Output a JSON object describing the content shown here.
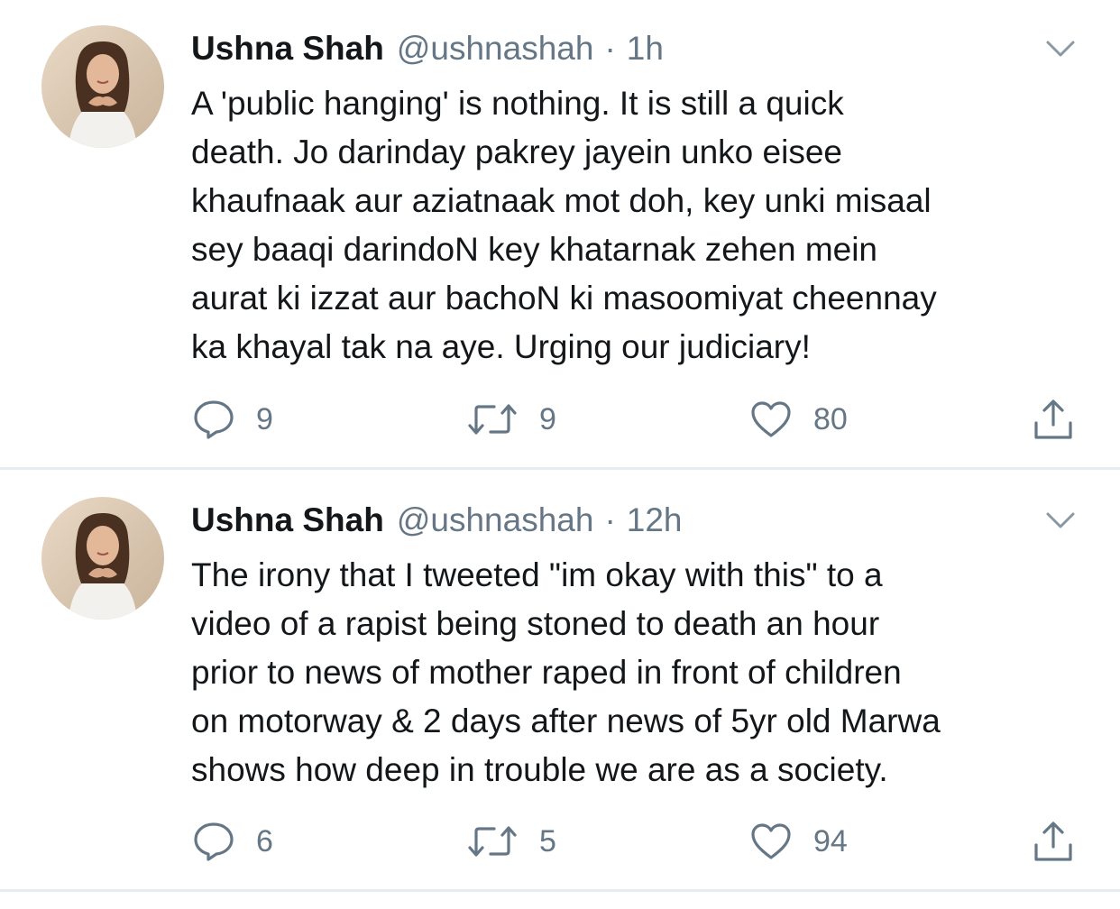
{
  "tweets": [
    {
      "display_name": "Ushna Shah",
      "handle": "@ushnashah",
      "separator": "·",
      "time": "1h",
      "text": "A 'public hanging' is nothing. It is still a quick\ndeath. Jo darinday pakrey jayein unko eisee\nkhaufnaak aur aziatnaak mot doh, key unki misaal\nsey baaqi darindoN key khatarnak zehen mein\naurat ki izzat aur bachoN ki masoomiyat cheennay\nka khayal tak na aye. Urging our judiciary!",
      "replies": "9",
      "retweets": "9",
      "likes": "80",
      "icons": {
        "reply": "reply-icon",
        "retweet": "retweet-icon",
        "like": "heart-icon",
        "share": "share-icon",
        "menu": "chevron-down-icon"
      }
    },
    {
      "display_name": "Ushna Shah",
      "handle": "@ushnashah",
      "separator": "·",
      "time": "12h",
      "text": "The irony that I tweeted \"im okay with this\" to a\nvideo of a rapist being stoned to death an hour\nprior to news of mother raped in front of children\non motorway & 2 days after news of 5yr old Marwa\nshows how deep in trouble we are as a society.",
      "replies": "6",
      "retweets": "5",
      "likes": "94",
      "icons": {
        "reply": "reply-icon",
        "retweet": "retweet-icon",
        "like": "heart-icon",
        "share": "share-icon",
        "menu": "chevron-down-icon"
      }
    }
  ],
  "colors": {
    "text_primary": "#14171a",
    "text_secondary": "#657786",
    "divider": "#e6ecf0"
  }
}
